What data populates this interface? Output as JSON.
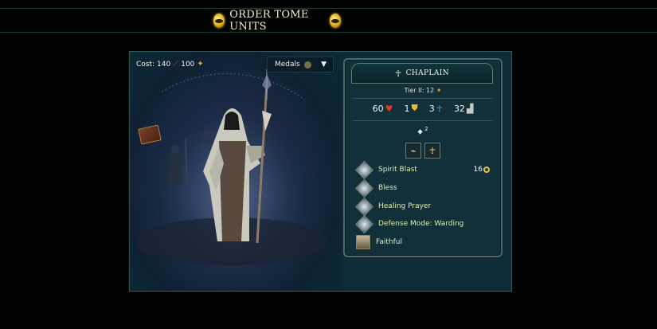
{
  "header": {
    "title": "ORDER TOME UNITS"
  },
  "unit": {
    "cost_label": "Cost:",
    "cost_mana": "140",
    "cost_gold": "100",
    "medals_label": "Medals",
    "name": "CHAPLAIN",
    "tier": "Tier II: 12",
    "stats": {
      "hp": "60",
      "defense": "1",
      "resistance": "3",
      "movement": "32"
    },
    "upkeep": "2",
    "abilities": [
      {
        "name": "Spirit Blast",
        "icon": "spirit-blast-icon"
      },
      {
        "name": "Bless",
        "icon": "bless-icon"
      },
      {
        "name": "Healing Prayer",
        "icon": "healing-prayer-icon"
      },
      {
        "name": "Defense Mode: Warding",
        "icon": "warding-icon"
      },
      {
        "name": "Faithful",
        "icon": "faithful-icon"
      }
    ],
    "ability_cost": "16"
  },
  "colors": {
    "accent": "#d9a70e",
    "panel": "#0c2b36",
    "ability_text": "#d8f0b8"
  }
}
